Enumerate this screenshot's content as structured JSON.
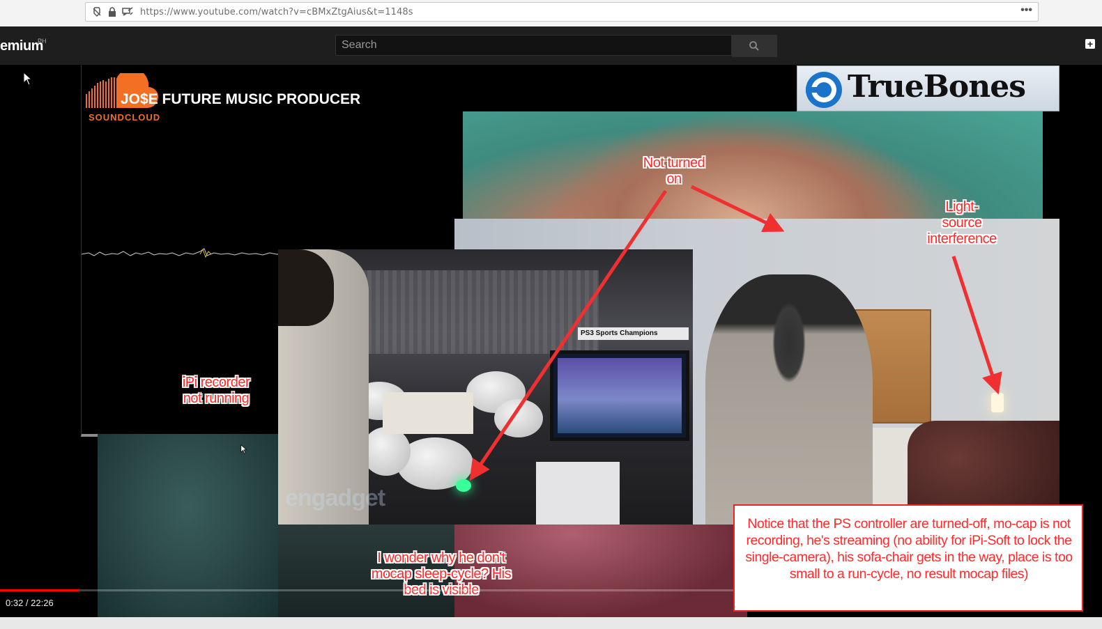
{
  "browser": {
    "url": "https://www.youtube.com/watch?v=cBMxZtgAius&t=1148s",
    "more_label": "•••"
  },
  "header": {
    "logo_text": "emium",
    "region": "PH",
    "search_placeholder": "Search",
    "create_icon": "plus-icon"
  },
  "video": {
    "soundcloud": {
      "title_artist": "JO$E",
      "title_rest": "FUTURE MUSIC PRODUCER",
      "brand": "SOUNDCLOUD"
    },
    "truebones_text": "TrueBones",
    "ps3_banner": "PS3  Sports Champions",
    "watermark": "engadget"
  },
  "annotations": {
    "not_turned_on": [
      "Not turned",
      "on"
    ],
    "light_source": [
      "Light-",
      "source",
      "interference"
    ],
    "ipi_recorder": [
      "iPi recorder",
      "not running"
    ],
    "wonder": [
      "I wonder why he don't",
      "mocap sleep-cycle? His",
      "bed is visible"
    ],
    "notice": "Notice that the PS controller are turned-off, mo-cap is not recording, he's streaming (no ability for iPi-Soft to lock the single-camera), his sofa-chair gets in the way, place is too small to a run-cycle, no result mocap files)"
  },
  "player": {
    "current_time": "0:32",
    "duration": "22:26",
    "time_display": "0:32 / 22:26",
    "progress_fraction": 0.0238
  },
  "colors": {
    "annotation_red": "#ff2a2a",
    "soundcloud_orange": "#f26f23",
    "progress_red": "#ff0000"
  }
}
